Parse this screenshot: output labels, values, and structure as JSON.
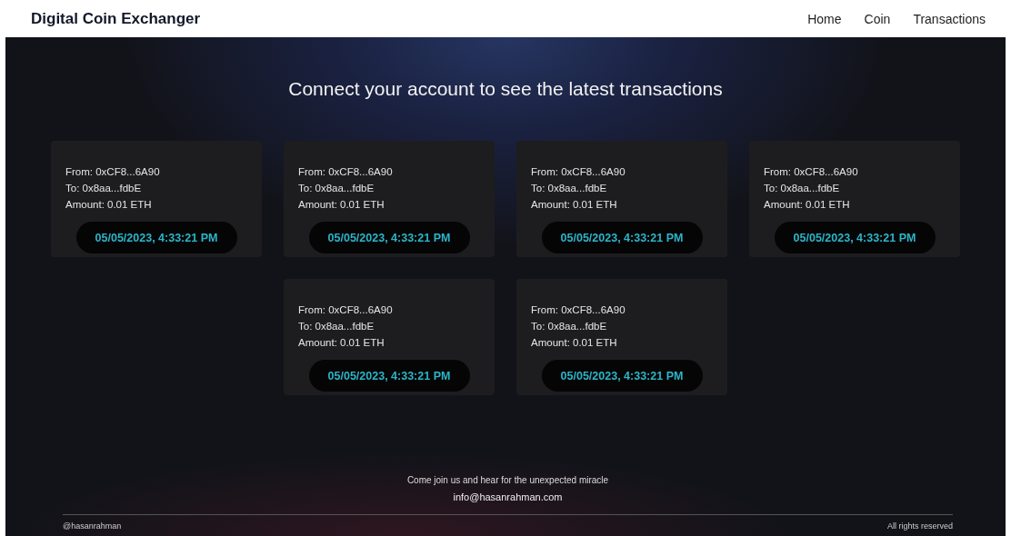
{
  "header": {
    "brand": "Digital Coin Exchanger",
    "nav": [
      "Home",
      "Coin",
      "Transactions"
    ]
  },
  "heading": "Connect your account to see the latest transactions",
  "transactions": [
    {
      "from": "From: 0xCF8...6A90",
      "to": "To: 0x8aa...fdbE",
      "amount": "Amount: 0.01 ETH",
      "timestamp": "05/05/2023, 4:33:21 PM"
    },
    {
      "from": "From: 0xCF8...6A90",
      "to": "To: 0x8aa...fdbE",
      "amount": "Amount: 0.01 ETH",
      "timestamp": "05/05/2023, 4:33:21 PM"
    },
    {
      "from": "From: 0xCF8...6A90",
      "to": "To: 0x8aa...fdbE",
      "amount": "Amount: 0.01 ETH",
      "timestamp": "05/05/2023, 4:33:21 PM"
    },
    {
      "from": "From: 0xCF8...6A90",
      "to": "To: 0x8aa...fdbE",
      "amount": "Amount: 0.01 ETH",
      "timestamp": "05/05/2023, 4:33:21 PM"
    },
    {
      "from": "From: 0xCF8...6A90",
      "to": "To: 0x8aa...fdbE",
      "amount": "Amount: 0.01 ETH",
      "timestamp": "05/05/2023, 4:33:21 PM"
    },
    {
      "from": "From: 0xCF8...6A90",
      "to": "To: 0x8aa...fdbE",
      "amount": "Amount: 0.01 ETH",
      "timestamp": "05/05/2023, 4:33:21 PM"
    }
  ],
  "footer": {
    "tagline": "Come join us and hear for the unexpected miracle",
    "email": "info@hasanrahman.com",
    "handle": "@hasanrahman",
    "rights": "All rights reserved"
  }
}
